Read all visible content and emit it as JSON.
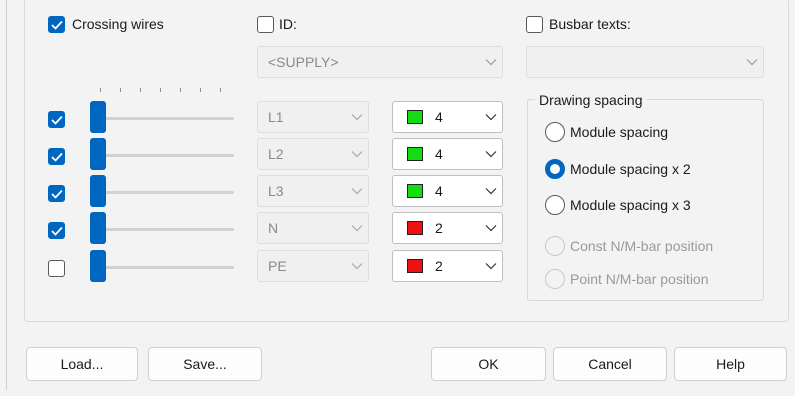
{
  "top": {
    "crossing_wires": {
      "label": "Crossing wires",
      "checked": true
    },
    "id": {
      "label": "ID:",
      "checked": false,
      "combo_value": "<SUPPLY>"
    },
    "busbar_texts": {
      "label": "Busbar texts:",
      "checked": false,
      "combo_value": ""
    }
  },
  "rows": [
    {
      "checked": true,
      "phase": "L1",
      "color_name": "green",
      "color_hex": "#11dd11",
      "value": "4"
    },
    {
      "checked": true,
      "phase": "L2",
      "color_name": "green",
      "color_hex": "#11dd11",
      "value": "4"
    },
    {
      "checked": true,
      "phase": "L3",
      "color_name": "green",
      "color_hex": "#11dd11",
      "value": "4"
    },
    {
      "checked": true,
      "phase": "N",
      "color_name": "red",
      "color_hex": "#ee1111",
      "value": "2"
    },
    {
      "checked": false,
      "phase": "PE",
      "color_name": "red",
      "color_hex": "#ee1111",
      "value": "2"
    }
  ],
  "drawing_spacing": {
    "title": "Drawing spacing",
    "options": [
      {
        "label": "Module spacing",
        "selected": false,
        "enabled": true
      },
      {
        "label": "Module spacing x 2",
        "selected": true,
        "enabled": true
      },
      {
        "label": "Module spacing x 3",
        "selected": false,
        "enabled": true
      },
      {
        "label": "Const N/M-bar position",
        "selected": false,
        "enabled": false
      },
      {
        "label": "Point N/M-bar position",
        "selected": false,
        "enabled": false
      }
    ]
  },
  "buttons": {
    "load": "Load...",
    "save": "Save...",
    "ok": "OK",
    "cancel": "Cancel",
    "help": "Help"
  },
  "colors": {
    "accent": "#0067c0"
  }
}
